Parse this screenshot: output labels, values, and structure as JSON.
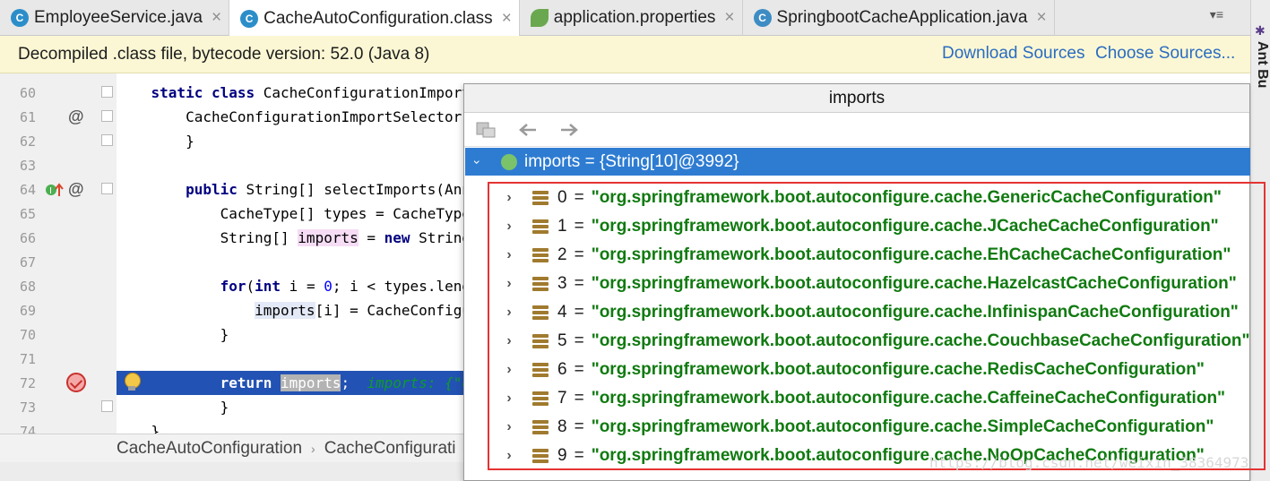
{
  "tabs": [
    {
      "label": "EmployeeService.java",
      "icon": "class-icon",
      "active": false
    },
    {
      "label": "CacheAutoConfiguration.class",
      "icon": "class-icon",
      "active": true
    },
    {
      "label": "application.properties",
      "icon": "properties-icon",
      "active": false
    },
    {
      "label": "SpringbootCacheApplication.java",
      "icon": "spring-app-icon",
      "active": false
    }
  ],
  "tab_close_glyph": "×",
  "tab_icon_letter": "C",
  "right_panel_label": "Ant Bu",
  "banner": {
    "text": "Decompiled .class file, bytecode version: 52.0 (Java 8)",
    "download_sources": "Download Sources",
    "choose_sources": "Choose Sources..."
  },
  "editor": {
    "line_numbers": [
      "60",
      "61",
      "62",
      "63",
      "64",
      "65",
      "66",
      "67",
      "68",
      "69",
      "70",
      "71",
      "72",
      "73",
      "74"
    ],
    "lines": {
      "l60_kw": "static class ",
      "l60_rest": "CacheConfigurationImportS",
      "l61": "    CacheConfigurationImportSelector()",
      "l62": "    }",
      "l64_kw": "public ",
      "l64_rest": "String[] selectImports(Anno",
      "l65": "        CacheType[] types = CacheType.v",
      "l66_a": "        String[] ",
      "l66_b": "imports",
      "l66_c": " = ",
      "l66_kw": "new ",
      "l66_d": "String[t",
      "l68_kw1": "for",
      "l68_a": "(",
      "l68_kw2": "int",
      "l68_b": " i = ",
      "l68_num": "0",
      "l68_c": "; i < types.length",
      "l69_a": "imports",
      "l69_b": "[i] = CacheConfigura",
      "l70": "        }",
      "l72_kw": "return ",
      "l72_var": "imports",
      "l72_semi": ";",
      "l72_inline": "  imports: {\"org",
      "l73": "    }",
      "l74": "}"
    },
    "gutter_marks": {
      "at": "@"
    }
  },
  "breadcrumb": [
    "CacheAutoConfiguration",
    "CacheConfigurati"
  ],
  "breadcrumb_sep": "›",
  "popup": {
    "title": "imports",
    "root": "imports = {String[10]@3992}",
    "items": [
      {
        "index": "0",
        "value": "\"org.springframework.boot.autoconfigure.cache.GenericCacheConfiguration\""
      },
      {
        "index": "1",
        "value": "\"org.springframework.boot.autoconfigure.cache.JCacheCacheConfiguration\""
      },
      {
        "index": "2",
        "value": "\"org.springframework.boot.autoconfigure.cache.EhCacheCacheConfiguration\""
      },
      {
        "index": "3",
        "value": "\"org.springframework.boot.autoconfigure.cache.HazelcastCacheConfiguration\""
      },
      {
        "index": "4",
        "value": "\"org.springframework.boot.autoconfigure.cache.InfinispanCacheConfiguration\""
      },
      {
        "index": "5",
        "value": "\"org.springframework.boot.autoconfigure.cache.CouchbaseCacheConfiguration\""
      },
      {
        "index": "6",
        "value": "\"org.springframework.boot.autoconfigure.cache.RedisCacheConfiguration\""
      },
      {
        "index": "7",
        "value": "\"org.springframework.boot.autoconfigure.cache.CaffeineCacheConfiguration\""
      },
      {
        "index": "8",
        "value": "\"org.springframework.boot.autoconfigure.cache.SimpleCacheConfiguration\""
      },
      {
        "index": "9",
        "value": "\"org.springframework.boot.autoconfigure.cache.NoOpCacheConfiguration\""
      }
    ],
    "eq": "="
  },
  "watermark": "https://blog.csdn.net/weixin_38364973",
  "colors": {
    "accent": "#2e7cd2",
    "highlight_line": "#2252b3",
    "value_green": "#107a10",
    "box_red": "#e53333"
  }
}
